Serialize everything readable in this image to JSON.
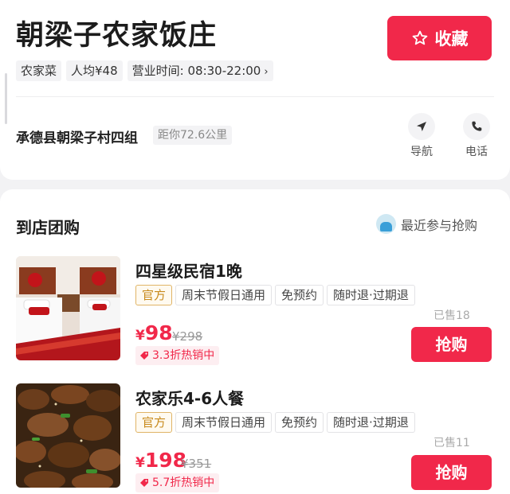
{
  "shop": {
    "name": "朝梁子农家饭庄",
    "favorite_label": "收藏",
    "tags": [
      "农家菜",
      "人均¥48",
      "营业时间: 08:30-22:00"
    ],
    "address": "承德县朝梁子村四组",
    "distance": "距你72.6公里",
    "actions": {
      "navigate": "导航",
      "call": "电话"
    }
  },
  "deals": {
    "title": "到店团购",
    "recent_label": "最近参与抢购",
    "items": [
      {
        "name": "四星级民宿1晚",
        "badges": [
          "官方",
          "周末节假日通用",
          "免预约",
          "随时退·过期退"
        ],
        "currency": "¥",
        "price": "98",
        "original_price": "¥298",
        "discount": "3.3折热销中",
        "sold": "已售18",
        "buy_label": "抢购"
      },
      {
        "name": "农家乐4-6人餐",
        "badges": [
          "官方",
          "周末节假日通用",
          "免预约",
          "随时退·过期退"
        ],
        "currency": "¥",
        "price": "198",
        "original_price": "¥351",
        "discount": "5.7折热销中",
        "sold": "已售11",
        "buy_label": "抢购"
      }
    ]
  },
  "colors": {
    "accent": "#f1284a",
    "official": "#c88a1c",
    "muted": "#999999"
  },
  "icons": [
    "star-icon",
    "chevron-right-icon",
    "navigation-arrow-icon",
    "phone-icon",
    "tag-icon",
    "avatar"
  ]
}
